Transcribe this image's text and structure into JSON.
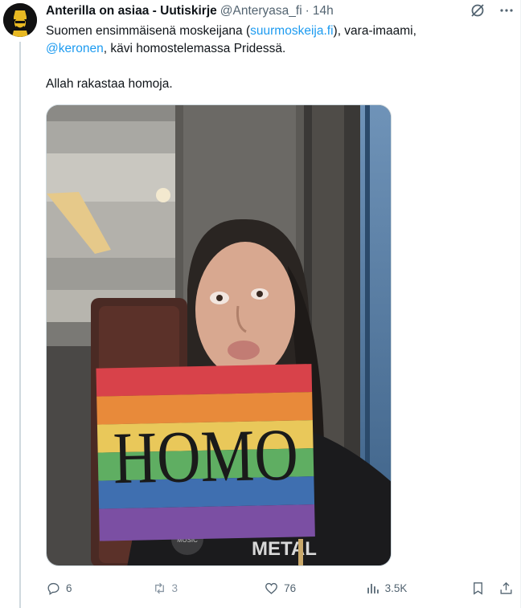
{
  "tweet": {
    "author": {
      "display_name": "Anterilla on asiaa - Uutiskirje",
      "handle": "@Anteryasa_fi",
      "separator": "·",
      "timestamp": "14h"
    },
    "text": {
      "line1_before": "Suomen ensimmäisenä moskeijana (",
      "link1": "suurmoskeija.fi",
      "line1_after": "), vara-imaami,",
      "mention": "@keronen",
      "line2_after": ", kävi homostelemassa Pridessä.",
      "line3": "Allah rakastaa homoja."
    },
    "media": {
      "flag_text": "HOMO",
      "shirt_text": "METAL",
      "patch_text": "MUSIC"
    },
    "stats": {
      "replies": "6",
      "retweets": "3",
      "likes": "76",
      "views": "3.5K"
    },
    "icons": {
      "header": [
        "grok-icon",
        "more-icon"
      ],
      "actions": [
        "reply-icon",
        "retweet-icon",
        "like-icon",
        "views-icon",
        "bookmark-icon",
        "share-icon"
      ]
    },
    "colors": {
      "link": "#1d9bf0",
      "secondary_text": "#536471",
      "thread_line": "#cfd9de",
      "avatar_accent": "#e8b923"
    }
  }
}
